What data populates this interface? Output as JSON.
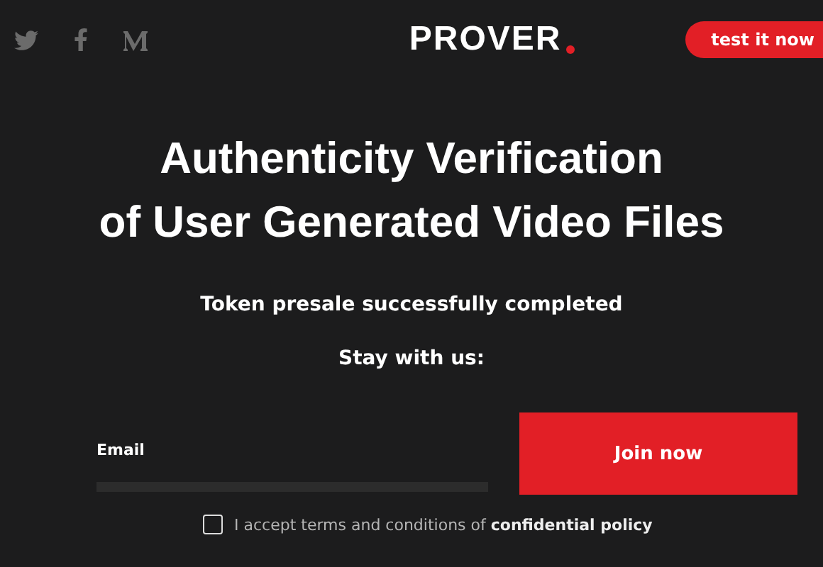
{
  "header": {
    "logo": "PROVER",
    "cta": "test it now"
  },
  "hero": {
    "title_lines": [
      "Authenticity Verification",
      "of User Generated Video Files"
    ],
    "subtitle": "Token presale successfully completed",
    "prompt": "Stay with us:"
  },
  "form": {
    "email_label": "Email",
    "button": "Join now",
    "consent": {
      "checked": false,
      "text": "I accept terms and conditions of **confidential policy**"
    }
  }
}
